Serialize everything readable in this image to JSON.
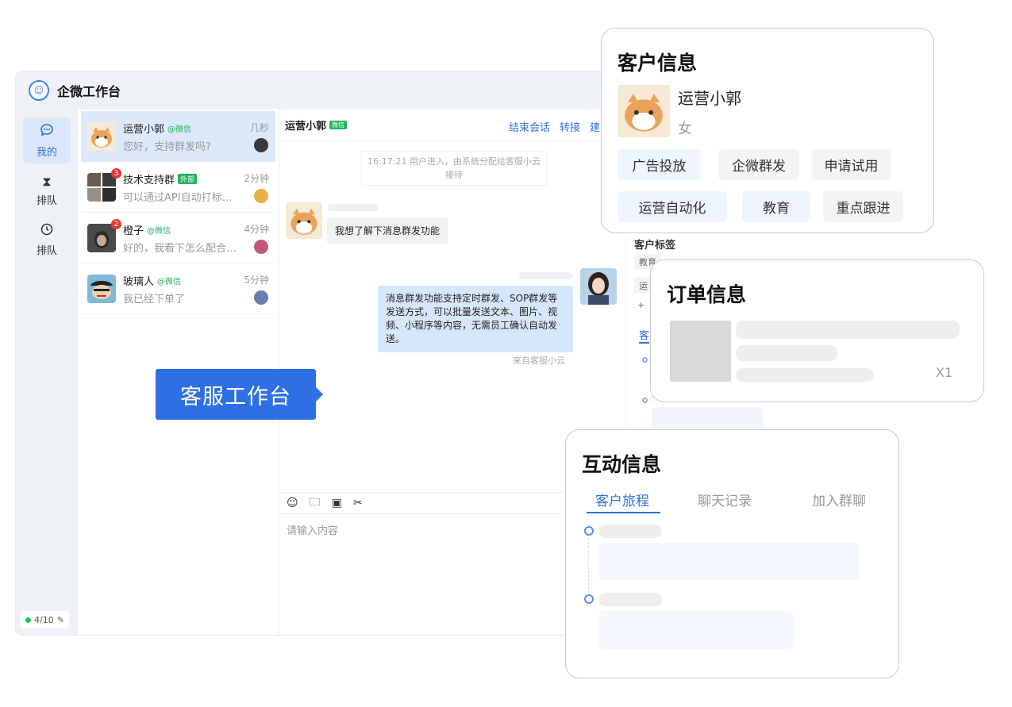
{
  "app": {
    "title": "企微工作台"
  },
  "rail": {
    "items": [
      {
        "label": "我的",
        "icon": "chat-bubble-icon"
      },
      {
        "label": "排队",
        "icon": "hourglass-icon"
      },
      {
        "label": "排队",
        "icon": "clock-icon"
      }
    ],
    "status": "4/10"
  },
  "conversations": [
    {
      "name": "运营小郭",
      "source": "@微信",
      "message": "您好，支持群发吗?",
      "time": "几秒"
    },
    {
      "name": "技术支持群",
      "tag": "外部",
      "badge": "3",
      "message": "可以通过API自动打标…",
      "time": "2分钟"
    },
    {
      "name": "橙子",
      "source": "@微信",
      "badge": "2",
      "message": "好的，我看下怎么配合…",
      "time": "4分钟"
    },
    {
      "name": "玻璃人",
      "source": "@微信",
      "message": "我已经下单了",
      "time": "5分钟"
    }
  ],
  "chat": {
    "contact": "运营小郭",
    "contact_tag": "微信",
    "actions": [
      "结束会话",
      "转接",
      "建"
    ],
    "system_note": "16:17:21 用户进入，由系统分配给客服小云接待",
    "incoming": "我想了解下消息群发功能",
    "outgoing": "消息群发功能支持定时群发、SOP群发等发送方式，可以批量发送文本、图片、视频、小程序等内容，无需员工确认自动发送。",
    "outgoing_from": "来自客服小云",
    "input_placeholder": "请输入内容"
  },
  "side_panel": {
    "title": "客户标签",
    "tag_fragments": [
      "教育",
      "运",
      "+",
      "客"
    ]
  },
  "callout": {
    "label": "客服工作台"
  },
  "customer_card": {
    "title": "客户信息",
    "name": "运营小郭",
    "gender": "女",
    "tags": [
      "广告投放",
      "企微群发",
      "申请试用",
      "运营自动化",
      "教育",
      "重点跟进"
    ]
  },
  "order_card": {
    "title": "订单信息",
    "quantity": "X1"
  },
  "interaction_card": {
    "title": "互动信息",
    "tabs": [
      "客户旅程",
      "聊天记录",
      "加入群聊"
    ]
  },
  "colors": {
    "accent": "#2f6fe4",
    "wechat_green": "#22b35a",
    "badge_red": "#e53935"
  }
}
